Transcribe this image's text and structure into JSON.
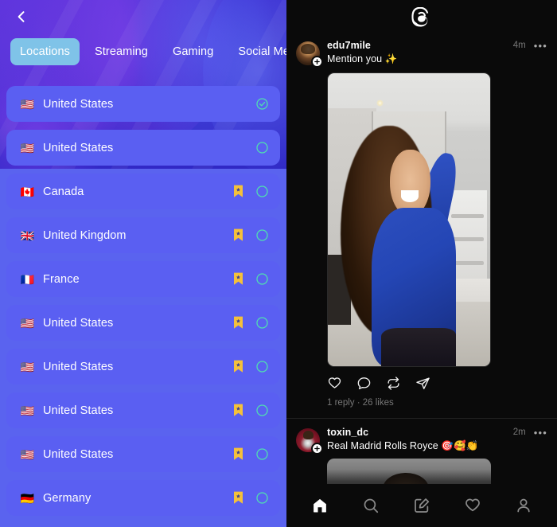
{
  "vpn_panel": {
    "back_icon": "chevron-left-icon",
    "tabs": [
      {
        "label": "Locations",
        "active": true
      },
      {
        "label": "Streaming",
        "active": false
      },
      {
        "label": "Gaming",
        "active": false
      },
      {
        "label": "Social Media",
        "active": false
      }
    ],
    "rows": [
      {
        "flag": "🇺🇸",
        "label": "United States",
        "bookmark": false,
        "selected": true
      },
      {
        "flag": "🇺🇸",
        "label": "United States",
        "bookmark": false,
        "selected": false
      },
      {
        "flag": "🇨🇦",
        "label": "Canada",
        "bookmark": true,
        "selected": false
      },
      {
        "flag": "🇬🇧",
        "label": "United Kingdom",
        "bookmark": true,
        "selected": false
      },
      {
        "flag": "🇫🇷",
        "label": "France",
        "bookmark": true,
        "selected": false
      },
      {
        "flag": "🇺🇸",
        "label": "United States",
        "bookmark": true,
        "selected": false
      },
      {
        "flag": "🇺🇸",
        "label": "United States",
        "bookmark": true,
        "selected": false
      },
      {
        "flag": "🇺🇸",
        "label": "United States",
        "bookmark": true,
        "selected": false
      },
      {
        "flag": "🇺🇸",
        "label": "United States",
        "bookmark": true,
        "selected": false
      },
      {
        "flag": "🇩🇪",
        "label": "Germany",
        "bookmark": true,
        "selected": false
      }
    ],
    "colors": {
      "row_bg": "#5a5ff2",
      "panel_bg_lower": "#5a63ef",
      "active_tab_bg": "#7fc3e8",
      "bookmark": "#f5c13a",
      "select_ring": "#4fe0b0"
    }
  },
  "threads_panel": {
    "logo_icon": "threads-logo-icon",
    "posts": [
      {
        "username": "edu7mile",
        "timestamp": "4m",
        "text": "Mention you ✨",
        "more_icon": "more-options-icon",
        "avatar_badge_icon": "plus-badge-icon",
        "actions": [
          "like-icon",
          "reply-icon",
          "repost-icon",
          "share-icon"
        ],
        "stats": "1 reply · 26 likes"
      },
      {
        "username": "toxin_dc",
        "timestamp": "2m",
        "text": "Real Madrid Rolls Royce 🎯🥰👏",
        "more_icon": "more-options-icon",
        "avatar_badge_icon": "plus-badge-icon"
      }
    ],
    "bottom_nav": [
      {
        "icon": "home-icon",
        "active": true
      },
      {
        "icon": "search-icon",
        "active": false
      },
      {
        "icon": "compose-icon",
        "active": false
      },
      {
        "icon": "heart-icon",
        "active": false
      },
      {
        "icon": "profile-icon",
        "active": false
      }
    ],
    "colors": {
      "bg": "#0a0a0a",
      "text": "#ffffff",
      "muted": "#777777"
    }
  }
}
